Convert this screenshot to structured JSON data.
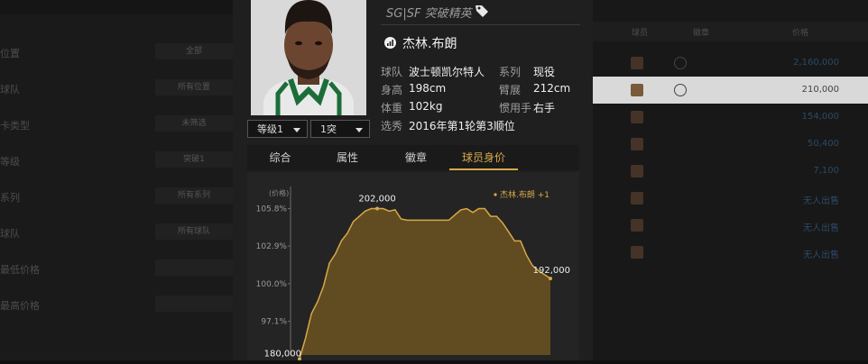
{
  "background": {
    "left_rows": [
      {
        "label": "位置",
        "value": "全部"
      },
      {
        "label": "球队",
        "value": "所有位置"
      },
      {
        "label": "卡类型",
        "value": "未筛选"
      },
      {
        "label": "等级",
        "value": "突破1"
      },
      {
        "label": "系列",
        "value": "所有系列"
      },
      {
        "label": "球队",
        "value": "所有球队"
      },
      {
        "label": "最低价格",
        "value": ""
      },
      {
        "label": "最高价格",
        "value": ""
      }
    ],
    "right_headers": [
      "球员",
      "徽章",
      "价格"
    ],
    "right_rows": [
      {
        "price": "2,160,000",
        "selected": false
      },
      {
        "price": "210,000",
        "selected": true
      },
      {
        "price": "154,000",
        "selected": false
      },
      {
        "price": "50,400",
        "selected": false
      },
      {
        "price": "7,100",
        "selected": false
      },
      {
        "price": "无人出售",
        "selected": false
      },
      {
        "price": "无人出售",
        "selected": false
      },
      {
        "price": "无人出售",
        "selected": false
      }
    ]
  },
  "player": {
    "position": "SG|SF 突破精英",
    "name": "杰林.布朗",
    "level_select": "等级1",
    "break_select": "1突",
    "info": [
      {
        "label": "球队",
        "value": "波士顿凯尔特人"
      },
      {
        "label": "系列",
        "value": "现役"
      },
      {
        "label": "身高",
        "value": "198cm"
      },
      {
        "label": "臂展",
        "value": "212cm"
      },
      {
        "label": "体重",
        "value": "102kg"
      },
      {
        "label": "惯用手",
        "value": "右手"
      },
      {
        "label": "选秀",
        "value": "2016年第1轮第3顺位"
      }
    ]
  },
  "tabs": [
    "综合",
    "属性",
    "徽章",
    "球员身价"
  ],
  "active_tab": 3,
  "colors": {
    "accent": "#d8a84a",
    "area_fill": "#6b5420",
    "line": "#d8a84a"
  },
  "chart_data": {
    "type": "area",
    "ylabel": "(价格)",
    "legend": "杰林.布朗 +1",
    "legend_position": "top-right",
    "yticks": [
      "105.8%",
      "102.9%",
      "100.0%",
      "97.1%"
    ],
    "ytick_values": [
      105.8,
      102.9,
      100.0,
      97.1
    ],
    "ylim": [
      94.5,
      107.5
    ],
    "y": [
      94.2,
      95.8,
      97.7,
      98.6,
      99.8,
      101.6,
      102.3,
      103.3,
      103.9,
      104.8,
      105.2,
      105.6,
      105.8,
      105.8,
      105.8,
      105.6,
      105.7,
      105.0,
      104.9,
      104.9,
      104.9,
      104.9,
      104.9,
      104.9,
      104.9,
      104.9,
      105.3,
      105.7,
      105.8,
      105.5,
      105.8,
      105.8,
      105.2,
      105.2,
      104.7,
      104.0,
      103.3,
      103.3,
      102.2,
      101.4,
      101.0,
      100.7,
      100.4
    ],
    "annotations": [
      {
        "text": "202,000",
        "index": 13
      },
      {
        "text": "192,000",
        "index": 42
      },
      {
        "text": "180,000",
        "index": 0
      }
    ]
  }
}
